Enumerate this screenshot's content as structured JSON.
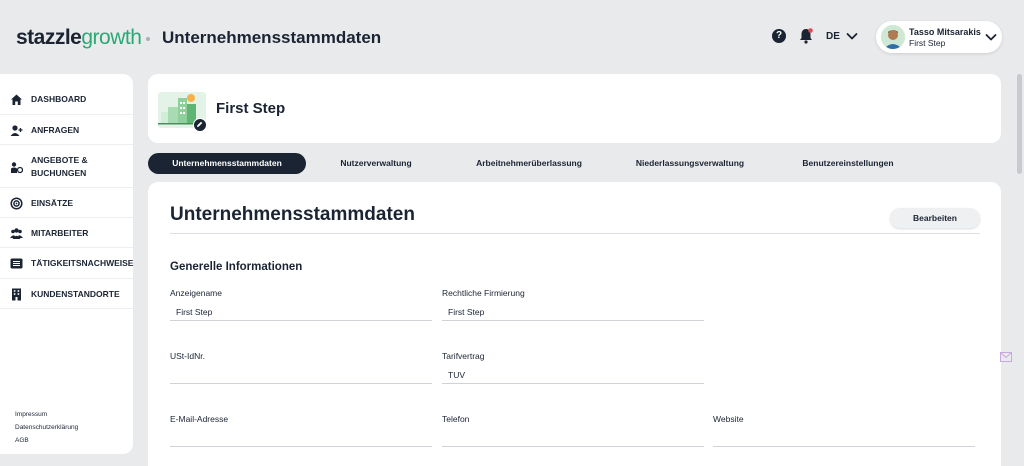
{
  "brand": {
    "part1": "stazzle",
    "part2": "growth"
  },
  "header": {
    "title": "Unternehmensstammdaten",
    "language": "DE",
    "user": {
      "name": "Tasso Mitsarakis",
      "company": "First Step"
    },
    "help_icon": "question-icon",
    "help_glyph": "?",
    "notification_icon": "bell-icon"
  },
  "sidebar": {
    "items": [
      {
        "label": "DASHBOARD",
        "icon": "home-icon"
      },
      {
        "label": "ANFRAGEN",
        "icon": "user-plus-icon"
      },
      {
        "label": "ANGEBOTE &",
        "label2": "BUCHUNGEN",
        "icon": "offers-icon"
      },
      {
        "label": "EINSÄTZE",
        "icon": "target-icon"
      },
      {
        "label": "MITARBEITER",
        "icon": "group-icon"
      },
      {
        "label": "TÄTIGKEITSNACHWEISE",
        "icon": "list-icon"
      },
      {
        "label": "KUNDENSTANDORTE",
        "icon": "building-icon"
      }
    ],
    "footer": [
      "Impressum",
      "Datenschutzerklärung",
      "AGB"
    ]
  },
  "company": {
    "name": "First Step"
  },
  "tabs": [
    {
      "label": "Unternehmensstammdaten",
      "active": true
    },
    {
      "label": "Nutzerverwaltung",
      "active": false
    },
    {
      "label": "Arbeitnehmerüberlassung",
      "active": false
    },
    {
      "label": "Niederlassungsverwaltung",
      "active": false
    },
    {
      "label": "Benutzereinstellungen",
      "active": false
    }
  ],
  "main": {
    "title": "Unternehmensstammdaten",
    "edit_label": "Bearbeiten",
    "section": "Generelle Informationen",
    "fields": [
      {
        "label": "Anzeigename",
        "value": "First Step"
      },
      {
        "label": "Rechtliche Firmierung",
        "value": "First Step"
      },
      {
        "label": "USt-IdNr.",
        "value": ""
      },
      {
        "label": "Tarifvertrag",
        "value": "TUV"
      },
      {
        "label": "E-Mail-Adresse",
        "value": ""
      },
      {
        "label": "Telefon",
        "value": ""
      },
      {
        "label": "Website",
        "value": ""
      }
    ]
  },
  "colors": {
    "primary": "#1b2433",
    "brand_green": "#2aa876",
    "background": "#e9eaec",
    "card": "#ffffff"
  }
}
